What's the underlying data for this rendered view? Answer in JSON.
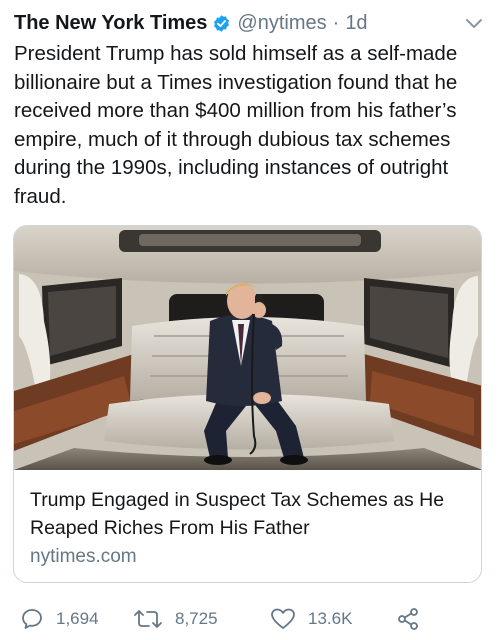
{
  "tweet": {
    "author_name": "The New York Times",
    "verified": true,
    "handle": "@nytimes",
    "separator": "·",
    "time_ago": "1d",
    "text": "President Trump has sold himself as a self-made billionaire but a Times investigation found that he received more than $400 million from his father’s empire, much of it through dubious tax schemes during the 1990s, including instances of outright fraud."
  },
  "card": {
    "image_icon": "photo-limousine-interior",
    "title": "Trump Engaged in Suspect Tax Schemes as He Reaped Riches From His Father",
    "domain": "nytimes.com"
  },
  "actions": {
    "reply_count": "1,694",
    "retweet_count": "8,725",
    "like_count": "13.6K"
  },
  "colors": {
    "text": "#14171a",
    "secondary": "#657786",
    "verified_blue": "#1da1f2",
    "border": "#ccd6dd"
  }
}
